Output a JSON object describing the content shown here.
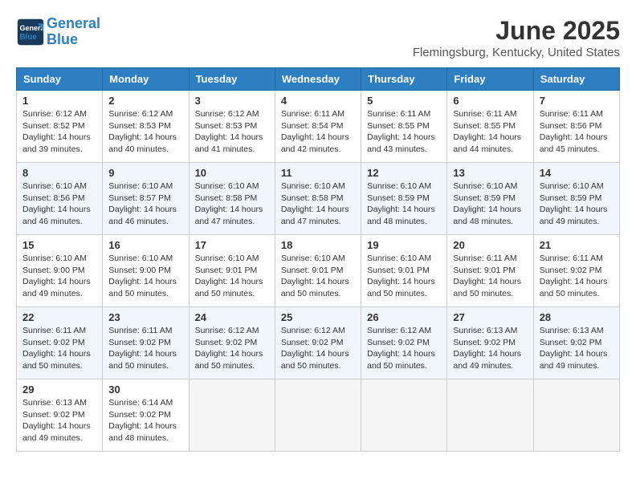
{
  "header": {
    "logo_line1": "General",
    "logo_line2": "Blue",
    "month_title": "June 2025",
    "location": "Flemingsburg, Kentucky, United States"
  },
  "days_of_week": [
    "Sunday",
    "Monday",
    "Tuesday",
    "Wednesday",
    "Thursday",
    "Friday",
    "Saturday"
  ],
  "weeks": [
    [
      {
        "day": "1",
        "sunrise": "6:12 AM",
        "sunset": "8:52 PM",
        "daylight": "14 hours and 39 minutes."
      },
      {
        "day": "2",
        "sunrise": "6:12 AM",
        "sunset": "8:53 PM",
        "daylight": "14 hours and 40 minutes."
      },
      {
        "day": "3",
        "sunrise": "6:12 AM",
        "sunset": "8:53 PM",
        "daylight": "14 hours and 41 minutes."
      },
      {
        "day": "4",
        "sunrise": "6:11 AM",
        "sunset": "8:54 PM",
        "daylight": "14 hours and 42 minutes."
      },
      {
        "day": "5",
        "sunrise": "6:11 AM",
        "sunset": "8:55 PM",
        "daylight": "14 hours and 43 minutes."
      },
      {
        "day": "6",
        "sunrise": "6:11 AM",
        "sunset": "8:55 PM",
        "daylight": "14 hours and 44 minutes."
      },
      {
        "day": "7",
        "sunrise": "6:11 AM",
        "sunset": "8:56 PM",
        "daylight": "14 hours and 45 minutes."
      }
    ],
    [
      {
        "day": "8",
        "sunrise": "6:10 AM",
        "sunset": "8:56 PM",
        "daylight": "14 hours and 46 minutes."
      },
      {
        "day": "9",
        "sunrise": "6:10 AM",
        "sunset": "8:57 PM",
        "daylight": "14 hours and 46 minutes."
      },
      {
        "day": "10",
        "sunrise": "6:10 AM",
        "sunset": "8:58 PM",
        "daylight": "14 hours and 47 minutes."
      },
      {
        "day": "11",
        "sunrise": "6:10 AM",
        "sunset": "8:58 PM",
        "daylight": "14 hours and 47 minutes."
      },
      {
        "day": "12",
        "sunrise": "6:10 AM",
        "sunset": "8:59 PM",
        "daylight": "14 hours and 48 minutes."
      },
      {
        "day": "13",
        "sunrise": "6:10 AM",
        "sunset": "8:59 PM",
        "daylight": "14 hours and 48 minutes."
      },
      {
        "day": "14",
        "sunrise": "6:10 AM",
        "sunset": "8:59 PM",
        "daylight": "14 hours and 49 minutes."
      }
    ],
    [
      {
        "day": "15",
        "sunrise": "6:10 AM",
        "sunset": "9:00 PM",
        "daylight": "14 hours and 49 minutes."
      },
      {
        "day": "16",
        "sunrise": "6:10 AM",
        "sunset": "9:00 PM",
        "daylight": "14 hours and 50 minutes."
      },
      {
        "day": "17",
        "sunrise": "6:10 AM",
        "sunset": "9:01 PM",
        "daylight": "14 hours and 50 minutes."
      },
      {
        "day": "18",
        "sunrise": "6:10 AM",
        "sunset": "9:01 PM",
        "daylight": "14 hours and 50 minutes."
      },
      {
        "day": "19",
        "sunrise": "6:10 AM",
        "sunset": "9:01 PM",
        "daylight": "14 hours and 50 minutes."
      },
      {
        "day": "20",
        "sunrise": "6:11 AM",
        "sunset": "9:01 PM",
        "daylight": "14 hours and 50 minutes."
      },
      {
        "day": "21",
        "sunrise": "6:11 AM",
        "sunset": "9:02 PM",
        "daylight": "14 hours and 50 minutes."
      }
    ],
    [
      {
        "day": "22",
        "sunrise": "6:11 AM",
        "sunset": "9:02 PM",
        "daylight": "14 hours and 50 minutes."
      },
      {
        "day": "23",
        "sunrise": "6:11 AM",
        "sunset": "9:02 PM",
        "daylight": "14 hours and 50 minutes."
      },
      {
        "day": "24",
        "sunrise": "6:12 AM",
        "sunset": "9:02 PM",
        "daylight": "14 hours and 50 minutes."
      },
      {
        "day": "25",
        "sunrise": "6:12 AM",
        "sunset": "9:02 PM",
        "daylight": "14 hours and 50 minutes."
      },
      {
        "day": "26",
        "sunrise": "6:12 AM",
        "sunset": "9:02 PM",
        "daylight": "14 hours and 50 minutes."
      },
      {
        "day": "27",
        "sunrise": "6:13 AM",
        "sunset": "9:02 PM",
        "daylight": "14 hours and 49 minutes."
      },
      {
        "day": "28",
        "sunrise": "6:13 AM",
        "sunset": "9:02 PM",
        "daylight": "14 hours and 49 minutes."
      }
    ],
    [
      {
        "day": "29",
        "sunrise": "6:13 AM",
        "sunset": "9:02 PM",
        "daylight": "14 hours and 49 minutes."
      },
      {
        "day": "30",
        "sunrise": "6:14 AM",
        "sunset": "9:02 PM",
        "daylight": "14 hours and 48 minutes."
      },
      null,
      null,
      null,
      null,
      null
    ]
  ]
}
